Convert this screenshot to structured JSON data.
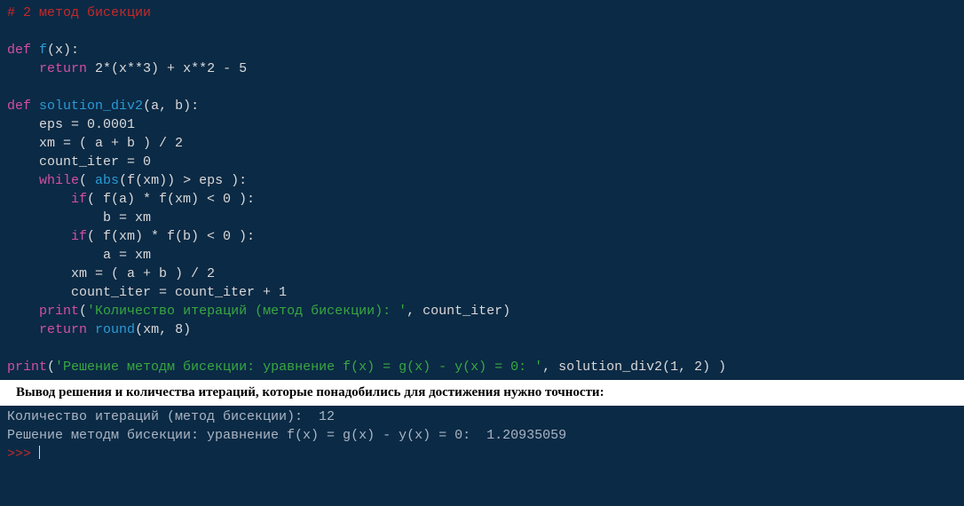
{
  "code": {
    "comment": "# 2 метод бисекции",
    "def1": "def",
    "fn1": "f",
    "fn1_args": "(x):",
    "ret1": "return",
    "fn1_body": "2*(x**3) + x**2 - 5",
    "def2": "def",
    "fn2": "solution_div2",
    "fn2_args": "(a, b):",
    "l_eps": "    eps = 0.0001",
    "l_xm": "    xm = ( a + b ) / 2",
    "l_ci": "    count_iter = 0",
    "kw_while": "while",
    "while_cond_pre": "( ",
    "abs_fn": "abs",
    "while_cond_post": "(f(xm)) > eps ):",
    "kw_if1": "if",
    "if1": "( f(a) * f(xm) < 0 ):",
    "if1_body": "            b = xm",
    "kw_if2": "if",
    "if2": "( f(xm) * f(b) < 0 ):",
    "if2_body": "            a = xm",
    "l_xm2": "        xm = ( a + b ) / 2",
    "l_ci2": "        count_iter = count_iter + 1",
    "kw_print1": "print",
    "str1": "'Количество итераций (метод бисекции): '",
    "print1_tail": ", count_iter)",
    "kw_ret2": "return",
    "round_fn": "round",
    "ret2_args": "(xm, 8)",
    "kw_print2": "print",
    "str2": "'Решение методм бисекции: уравнение f(x) = g(x) - y(x) = 0: '",
    "print2_tail": ", solution_div2(1, 2) )"
  },
  "caption": "Вывод решения и количества итераций, которые понадобились для достижения нужно точности:",
  "output": {
    "line1": "Количество итераций (метод бисекции):  12",
    "line2": "Решение методм бисекции: уравнение f(x) = g(x) - y(x) = 0:  1.20935059",
    "prompt": ">>> "
  }
}
